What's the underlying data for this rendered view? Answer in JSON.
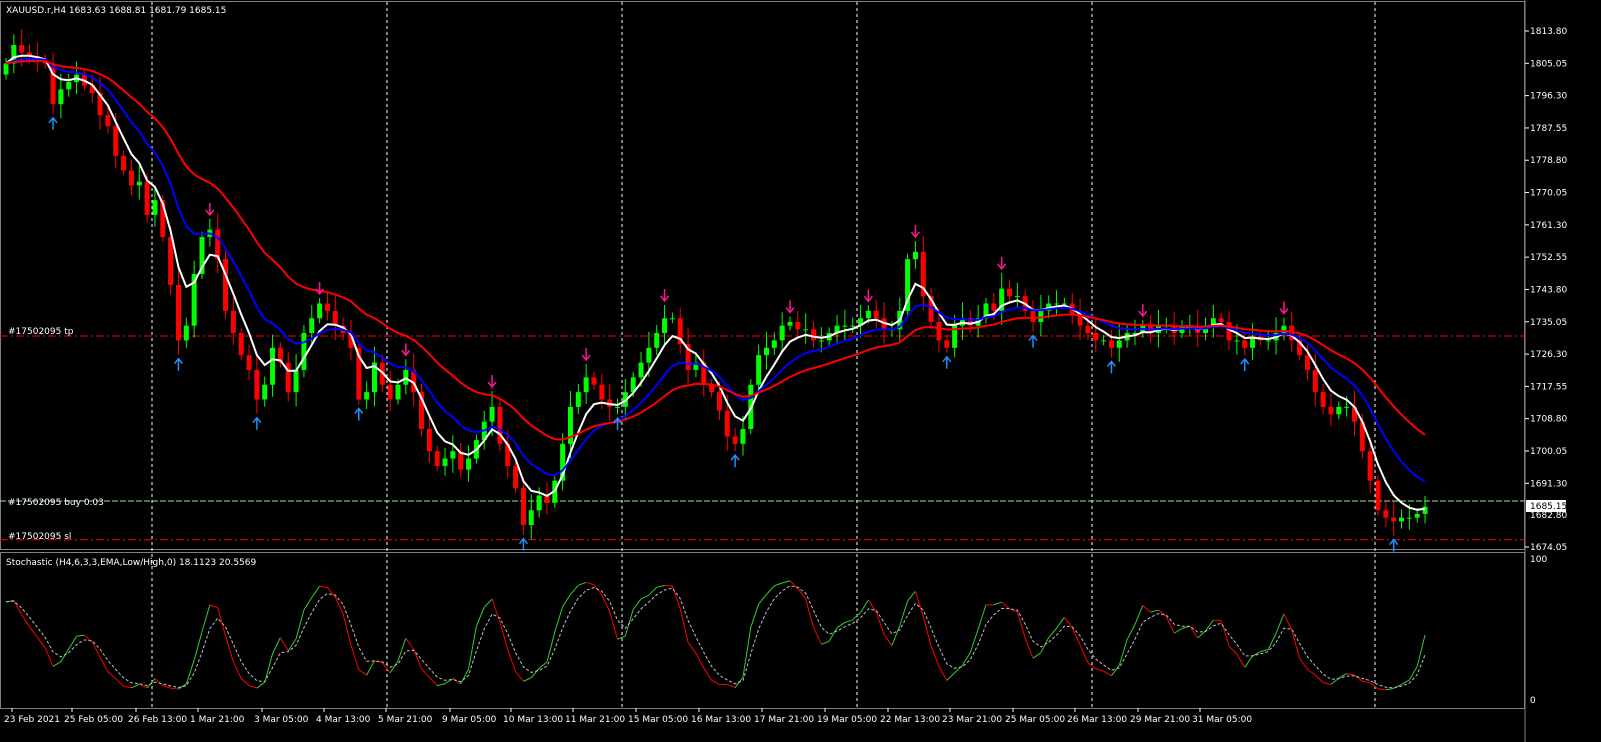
{
  "header": {
    "symbol_line": "XAUUSD.r,H4  1683.63 1688.81 1681.79 1685.15"
  },
  "stoch_header": "Stochastic (H4,6,3,3,EMA,Low/High,0) 18.1123 20.5569",
  "colors": {
    "background": "#000000",
    "bull": "#00ff00",
    "bear": "#ff0000",
    "ema_fast": "#ffffff",
    "ema_mid": "#0000ff",
    "ema_slow": "#ff0000",
    "arrow_up": "#1e90ff",
    "arrow_down": "#ff1493",
    "level_line": "#ff0000",
    "buy_line": "#90ee90",
    "stoch_main": "#32cd32",
    "stoch_signal": "#ff0000"
  },
  "orders": {
    "tp_label": "#17502095 tp",
    "buy_label": "#17502095 buy 0.03",
    "sl_label": "#17502095 sl",
    "tp_price": 1731.2,
    "buy_price": 1686.5,
    "sl_price": 1676.0
  },
  "price_tag": "1685.15",
  "price_tag_hidden": "1682.80",
  "stoch_axis": [
    "100",
    "0"
  ],
  "chart_data": {
    "type": "candlestick",
    "symbol": "XAUUSD.r",
    "timeframe": "H4",
    "ylim": [
      1670.0,
      1820.0
    ],
    "y_ticks": [
      "1813.80",
      "1805.05",
      "1796.30",
      "1787.55",
      "1778.80",
      "1770.05",
      "1761.30",
      "1752.55",
      "1743.80",
      "1735.05",
      "1726.30",
      "1717.55",
      "1708.80",
      "1700.05",
      "1691.30",
      "1682.80",
      "1674.05"
    ],
    "x_ticks": [
      "23 Feb 2021",
      "25 Feb 05:00",
      "26 Feb 13:00",
      "1 Mar 21:00",
      "3 Mar 05:00",
      "4 Mar 13:00",
      "5 Mar 21:00",
      "9 Mar 05:00",
      "10 Mar 13:00",
      "11 Mar 21:00",
      "15 Mar 05:00",
      "16 Mar 13:00",
      "17 Mar 21:00",
      "19 Mar 05:00",
      "22 Mar 13:00",
      "23 Mar 21:00",
      "25 Mar 05:00",
      "26 Mar 13:00",
      "29 Mar 21:00",
      "31 Mar 05:00"
    ],
    "close": [
      1805,
      1810,
      1808,
      1807,
      1806,
      1805,
      1794,
      1798,
      1800,
      1802,
      1799,
      1797,
      1791,
      1788,
      1780,
      1776,
      1772,
      1773,
      1764,
      1768,
      1758,
      1745,
      1730,
      1734,
      1748,
      1758,
      1760,
      1752,
      1738,
      1732,
      1726,
      1722,
      1714,
      1718,
      1728,
      1724,
      1716,
      1722,
      1732,
      1736,
      1740,
      1738,
      1734,
      1732,
      1728,
      1714,
      1716,
      1724,
      1718,
      1714,
      1718,
      1722,
      1716,
      1706,
      1700,
      1696,
      1698,
      1700,
      1695,
      1698,
      1703,
      1708,
      1712,
      1702,
      1696,
      1690,
      1680,
      1684,
      1688,
      1686,
      1692,
      1702,
      1712,
      1716,
      1720,
      1718,
      1714,
      1712,
      1712,
      1716,
      1720,
      1724,
      1728,
      1732,
      1736,
      1736,
      1729,
      1722,
      1724,
      1718,
      1716,
      1711,
      1704,
      1702,
      1706,
      1718,
      1726,
      1728,
      1730,
      1734,
      1735,
      1733,
      1733,
      1730,
      1730,
      1732,
      1734,
      1734,
      1734,
      1736,
      1738,
      1736,
      1733,
      1733,
      1738,
      1752,
      1754,
      1742,
      1735,
      1730,
      1728,
      1734,
      1736,
      1734,
      1736,
      1740,
      1738,
      1744,
      1742,
      1742,
      1738,
      1735,
      1738,
      1740,
      1740,
      1740,
      1737,
      1734,
      1732,
      1730,
      1730,
      1728,
      1730,
      1732,
      1732,
      1734,
      1732,
      1734,
      1734,
      1732,
      1734,
      1734,
      1732,
      1734,
      1736,
      1735,
      1730,
      1730,
      1728,
      1731,
      1730,
      1730,
      1732,
      1734,
      1730,
      1726,
      1722,
      1716,
      1712,
      1710,
      1712,
      1712,
      1708,
      1700,
      1692,
      1684,
      1682,
      1681,
      1682,
      1682,
      1683,
      1685
    ]
  }
}
